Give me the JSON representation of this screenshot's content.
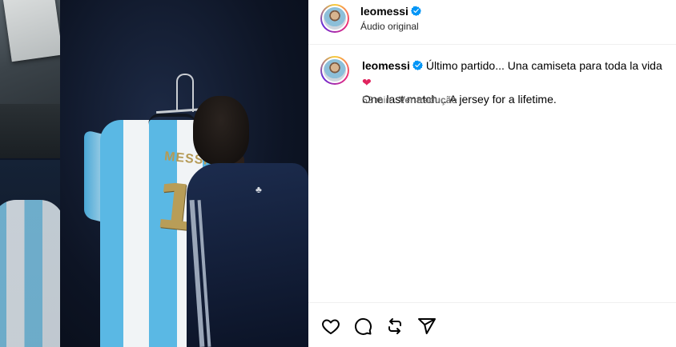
{
  "post": {
    "username": "leomessi",
    "audio_label": "Áudio original",
    "caption_line1": "Último partido... Una camiseta para toda la vida",
    "caption_emoji": "❤",
    "caption_line2": "One last match... A jersey for a lifetime.",
    "timestamp": "52 min",
    "see_translation": "Ver tradução"
  },
  "media": {
    "jersey_name": "MESSI",
    "jersey_number": "10",
    "logo_glyph": "♣"
  },
  "icons": {
    "verified": "verified-badge-icon",
    "like": "heart-icon",
    "comment": "comment-icon",
    "repost": "repost-icon",
    "share": "share-icon"
  },
  "colors": {
    "verified_blue": "#0095f6",
    "meta_gray": "#737373",
    "border": "#efefef"
  }
}
